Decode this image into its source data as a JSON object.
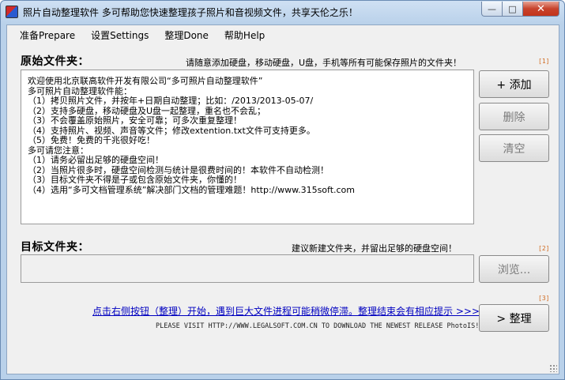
{
  "window": {
    "title": "照片自动整理软件 多可帮助您快速整理孩子照片和音视频文件，共享天伦之乐！"
  },
  "menu": [
    "准备Prepare",
    "设置Settings",
    "整理Done",
    "帮助Help"
  ],
  "source": {
    "label": "原始文件夹：",
    "hint": "请随意添加硬盘，移动硬盘，U盘，手机等所有可能保存照片的文件夹！",
    "corner": "[1]",
    "lines": [
      "欢迎使用北京联高软件开发有限公司“多可照片自动整理软件”",
      "",
      "多可照片自动整理软件能：",
      "（1）拷贝照片文件，并按年+日期自动整理；比如：/2013/2013-05-07/",
      "（2）支持多硬盘，移动硬盘及U盘一起整理，重名也不会乱；",
      "（3）不会覆盖原始照片，安全可靠；可多次重复整理！",
      "（4）支持照片、视频、声音等文件；修改extention.txt文件可支持更多。",
      "（5）免费！免费的千兆很好吃！",
      "",
      "多可请您注意：",
      "（1）请务必留出足够的硬盘空间！",
      "（2）当照片很多时，硬盘空间检测与统计是很费时间的！本软件不自动检测！",
      "（3）目标文件夹不得是子或包含原始文件夹，你懂的！",
      "（4）选用“多可文档管理系统”解决部门文档的管理难题！http://www.315soft.com"
    ],
    "buttons": {
      "add": "+ 添加",
      "delete": "删除",
      "clear": "清空"
    }
  },
  "target": {
    "label": "目标文件夹：",
    "hint": "建议新建文件夹，并留出足够的硬盘空间！",
    "corner": "[2]",
    "value": "",
    "browse": "浏览..."
  },
  "organize": {
    "corner": "[3]",
    "link": "点击右侧按钮（整理）开始，遇到巨大文件进程可能稍微停滞。整理结束会有相应提示 >>>",
    "visit": "PLEASE VISIT HTTP://WWW.LEGALSOFT.COM.CN TO DOWNLOAD THE NEWEST RELEASE PhotoIS!",
    "button": "> 整理"
  }
}
